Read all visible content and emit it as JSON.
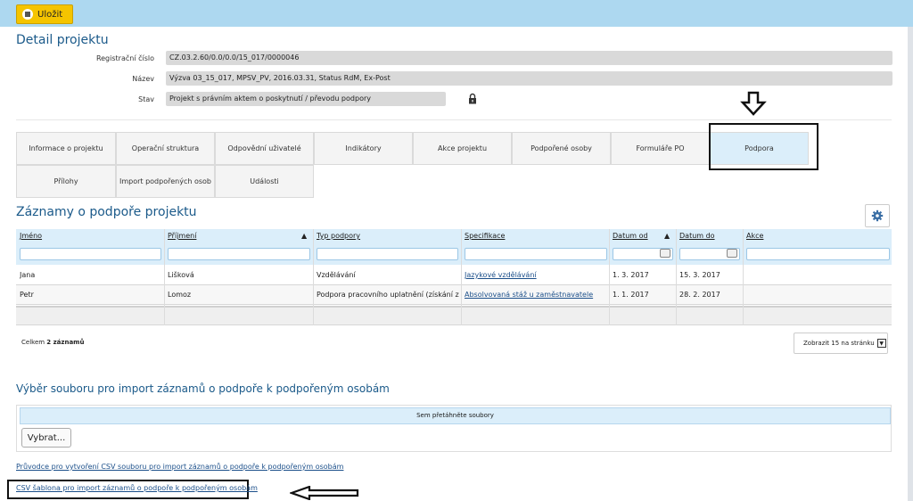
{
  "toolbar": {
    "save_label": "Uložit"
  },
  "page_title": "Detail projektu",
  "fields": {
    "reg_label": "Registrační číslo",
    "reg_value": "CZ.03.2.60/0.0/0.0/15_017/0000046",
    "name_label": "Název",
    "name_value": "Výzva 03_15_017, MPSV_PV, 2016.03.31, Status RdM, Ex-Post",
    "state_label": "Stav",
    "state_value": "Projekt s právním aktem o poskytnutí / převodu podpory"
  },
  "tabs": [
    "Informace o projektu",
    "Operační struktura",
    "Odpovědní uživatelé",
    "Indikátory",
    "Akce projektu",
    "Podpořené osoby",
    "Formuláře PO",
    "Podpora",
    "Přílohy",
    "Import podpořených osob",
    "Události"
  ],
  "records": {
    "title": "Záznamy o podpoře projektu",
    "columns": [
      "Jméno",
      "Příjmení",
      "Typ podpory",
      "Specifikace",
      "Datum od",
      "Datum do",
      "Akce"
    ],
    "rows": [
      [
        "Jana",
        "Lišková",
        "Vzdělávání",
        "Jazykové vzdělávání",
        "1. 3. 2017",
        "15. 3. 2017",
        ""
      ],
      [
        "Petr",
        "Lomoz",
        "Podpora pracovního uplatnění (získání za...",
        "Absolvovaná stáž u zaměstnavatele",
        "1. 1. 2017",
        "28. 2. 2017",
        ""
      ]
    ],
    "total_prefix": "Celkem ",
    "total_count": "2 záznamů",
    "pager_label": "Zobrazit 15 na stránku"
  },
  "import": {
    "title": "Výběr souboru pro import záznamů o podpoře k podpořeným osobám",
    "dropzone": "Sem přetáhněte soubory",
    "choose_label": "Vybrat...",
    "guide_link": "Průvodce pro vytvoření CSV souboru pro import záznamů o podpoře k podpořeným osobám",
    "template_link": "CSV šablona pro import záznamů o podpoře k podpořeným osobám"
  },
  "colors": {
    "accent": "#1b5a8a",
    "toolbar": "#add8f0",
    "save": "#f5c400",
    "grid_header": "#dbeefa"
  },
  "icons": [
    "floppy-icon",
    "lock-icon",
    "gear-icon",
    "calendar-icon",
    "sort-asc-icon",
    "chevron-down-icon",
    "arrow-down-icon",
    "arrow-left-icon"
  ]
}
